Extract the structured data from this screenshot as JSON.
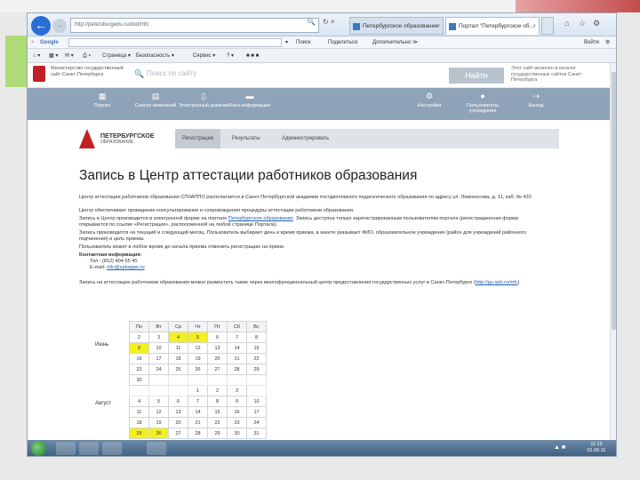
{
  "browser": {
    "url": "http://petersburgedu.ru/dod/mfc",
    "tab1_title": "Петербургское образование",
    "tab2_title": "Портал \"Петербургское об...",
    "close": "×"
  },
  "google_bar": {
    "logo": "Google",
    "search": "Поиск",
    "share": "Поделиться",
    "more": "Дополнительно ≫",
    "login": "Войти"
  },
  "favorites_bar": {
    "page": "Страница ▾",
    "safety": "Безопасность ▾",
    "service": "Сервис ▾"
  },
  "portal": {
    "logo_text": "Министерство государственный сайт Санкт-Петербурга",
    "search_placeholder": "Поиск по сайту",
    "find_button": "Найти",
    "right_text": "Этот сайт включен в каталог государственных сайтов Санкт-Петербурга",
    "nav": [
      {
        "label": "Портал",
        "icon": "grid-icon"
      },
      {
        "label": "Список заявлений",
        "icon": "list-icon"
      },
      {
        "label": "Электронный дневник",
        "icon": "book-icon"
      },
      {
        "label": "Банк информации",
        "icon": "folder-icon"
      },
      {
        "label": "Настройки",
        "icon": "gear-icon"
      },
      {
        "label": "Пользователь учреждения",
        "icon": "user-icon"
      },
      {
        "label": "Выход",
        "icon": "exit-icon"
      }
    ],
    "sub_logo_main": "ПЕТЕРБУРГСКОЕ",
    "sub_logo_small": "ОБРАЗОВАНИЕ",
    "sub_tabs": [
      "Регистрация",
      "Результаты",
      "Администрировать"
    ]
  },
  "content": {
    "title": "Запись в Центр аттестации работников образования",
    "para1": "Центр аттестации работников образования СПбАППО располагается в Санкт-Петербургской академии постдипломного педагогического образования по адресу ул. Ломоносова, д. 11, каб. № 420",
    "para2": "Центр обеспечивает проведение консультирования и сопровождения процедуры аттестации работников образования.",
    "para3_a": "Запись в Центр производится в электронной форме на портале",
    "para3_link": "Петербургское образование",
    "para3_b": ". Запись доступна только зарегистрированным пользователям портала (регистрационная форма открывается по ссылке «Регистрация», расположенной на любой странице Портала).",
    "para4": "Запись производится на текущий и следующий месяц. Пользователь выбирает день и время приема, в анкете указывает ФИО, образовательное учреждение (район для учреждений районного подчинения) и цель приема.",
    "para5": "Пользователь может в любое время до начала приема отменить регистрацию на прием.",
    "contacts_title": "Контактная информация:",
    "phone": "Тел.: (812) 404 65 45",
    "email_label": "E-mail: ",
    "email_link": "mfc@spbappo.ru",
    "para6": "Запись на аттестацию работников образования можно разместить также через многофункциональный центр предоставления государственных услуг в Санкт-Петербурге",
    "para6_link": "http://gu.spb.ru/mfc"
  },
  "calendar": {
    "weekdays": [
      "Пн",
      "Вт",
      "Ср",
      "Чт",
      "Пт",
      "Сб",
      "Вс"
    ],
    "month1": "Июнь",
    "month2": "Август",
    "rows": [
      {
        "cells": [
          "2",
          "3",
          "4",
          "5",
          "6",
          "7",
          "8"
        ],
        "hl": [
          2,
          3
        ]
      },
      {
        "cells": [
          "9",
          "10",
          "11",
          "12",
          "13",
          "14",
          "15"
        ],
        "hl": [
          0
        ]
      },
      {
        "cells": [
          "16",
          "17",
          "18",
          "19",
          "20",
          "21",
          "22"
        ],
        "hl": []
      },
      {
        "cells": [
          "23",
          "24",
          "25",
          "26",
          "27",
          "28",
          "29"
        ],
        "hl": []
      },
      {
        "cells": [
          "30",
          "",
          "",
          "",
          "",
          "",
          ""
        ],
        "hl": []
      },
      {
        "cells": [
          "",
          "",
          "",
          "1",
          "2",
          "3",
          ""
        ],
        "hl": []
      },
      {
        "cells": [
          "4",
          "5",
          "6",
          "7",
          "8",
          "9",
          "10"
        ],
        "hl": []
      },
      {
        "cells": [
          "11",
          "12",
          "13",
          "14",
          "15",
          "16",
          "17"
        ],
        "hl": []
      },
      {
        "cells": [
          "18",
          "19",
          "20",
          "21",
          "22",
          "23",
          "24"
        ],
        "hl": []
      },
      {
        "cells": [
          "25",
          "26",
          "27",
          "28",
          "29",
          "30",
          "31"
        ],
        "hl": [
          0,
          1
        ]
      }
    ]
  },
  "taskbar": {
    "clock_time": "11:19",
    "clock_date": "01.06.11"
  }
}
